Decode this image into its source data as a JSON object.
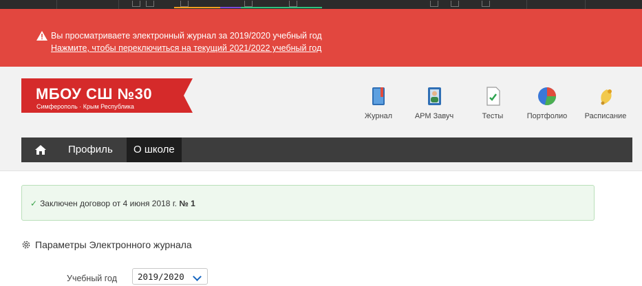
{
  "alert": {
    "line1": "Вы просматриваете электронный журнал за 2019/2020 учебный год",
    "line2": "Нажмите, чтобы переключиться на текущий 2021/2022 учебный год"
  },
  "school": {
    "name": "МБОУ СШ №30",
    "subtitle": "Симферополь · Крым Республика"
  },
  "nav_icons": [
    {
      "label": "Журнал",
      "icon": "journal-icon"
    },
    {
      "label": "АРМ Завуч",
      "icon": "deputy-icon"
    },
    {
      "label": "Тесты",
      "icon": "tests-icon"
    },
    {
      "label": "Портфолио",
      "icon": "portfolio-icon"
    },
    {
      "label": "Расписание",
      "icon": "bell-icon"
    }
  ],
  "menu": {
    "profile": "Профиль",
    "about": "О школе"
  },
  "contract": {
    "text": "Заключен договор от 4 июня 2018 г. ",
    "number": "№ 1"
  },
  "section": {
    "title": "Параметры Электронного журнала"
  },
  "year": {
    "label": "Учебный год",
    "value": "2019/2020"
  },
  "colors": {
    "alert_bg": "#e2473f",
    "banner_red": "#d52a2a",
    "menu_bg": "#3d3d3d",
    "success_bg": "#eef8ee",
    "accent_blue": "#1565c0"
  }
}
